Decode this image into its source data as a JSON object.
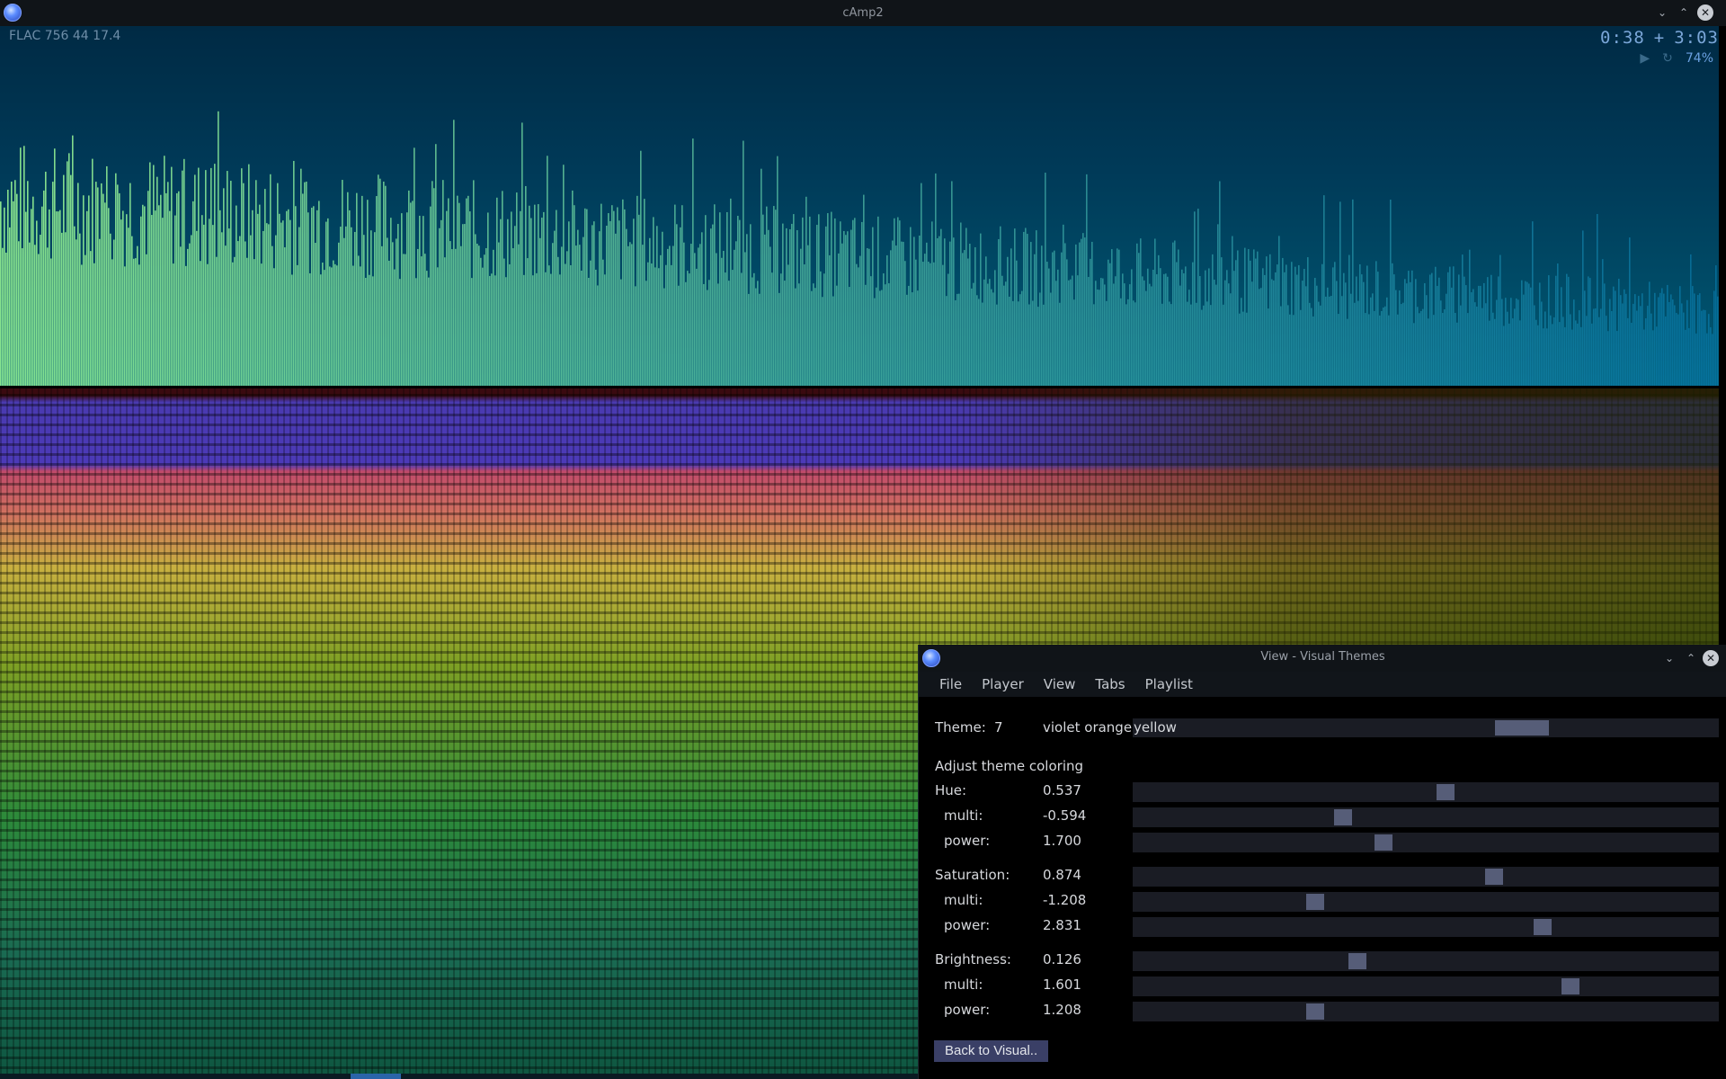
{
  "window": {
    "title": "cAmp2"
  },
  "viz": {
    "info": "FLAC 756 44  17.4",
    "time_elapsed": "0:38",
    "time_sep": "+",
    "time_total": "3:03",
    "volume": "74%"
  },
  "dialog": {
    "title": "View - Visual Themes",
    "menu": [
      "File",
      "Player",
      "View",
      "Tabs",
      "Playlist"
    ],
    "theme_label": "Theme:",
    "theme_number": "7",
    "theme_name": "violet orange",
    "theme_name_2": "yellow",
    "theme_position": 0.68,
    "adjust_label": "Adjust theme coloring",
    "rows": [
      {
        "label": "Hue:",
        "value": "0.537",
        "pos": 0.535
      },
      {
        "label": "multi:",
        "value": "-0.594",
        "pos": 0.355
      },
      {
        "label": "power:",
        "value": "1.700",
        "pos": 0.425
      },
      {
        "label": "Saturation:",
        "value": "0.874",
        "pos": 0.62
      },
      {
        "label": "multi:",
        "value": "-1.208",
        "pos": 0.305
      },
      {
        "label": "power:",
        "value": "2.831",
        "pos": 0.705
      },
      {
        "label": "Brightness:",
        "value": "0.126",
        "pos": 0.38
      },
      {
        "label": "multi:",
        "value": "1.601",
        "pos": 0.755
      },
      {
        "label": "power:",
        "value": "1.208",
        "pos": 0.305
      }
    ],
    "back_button": "Back to Visual.."
  }
}
